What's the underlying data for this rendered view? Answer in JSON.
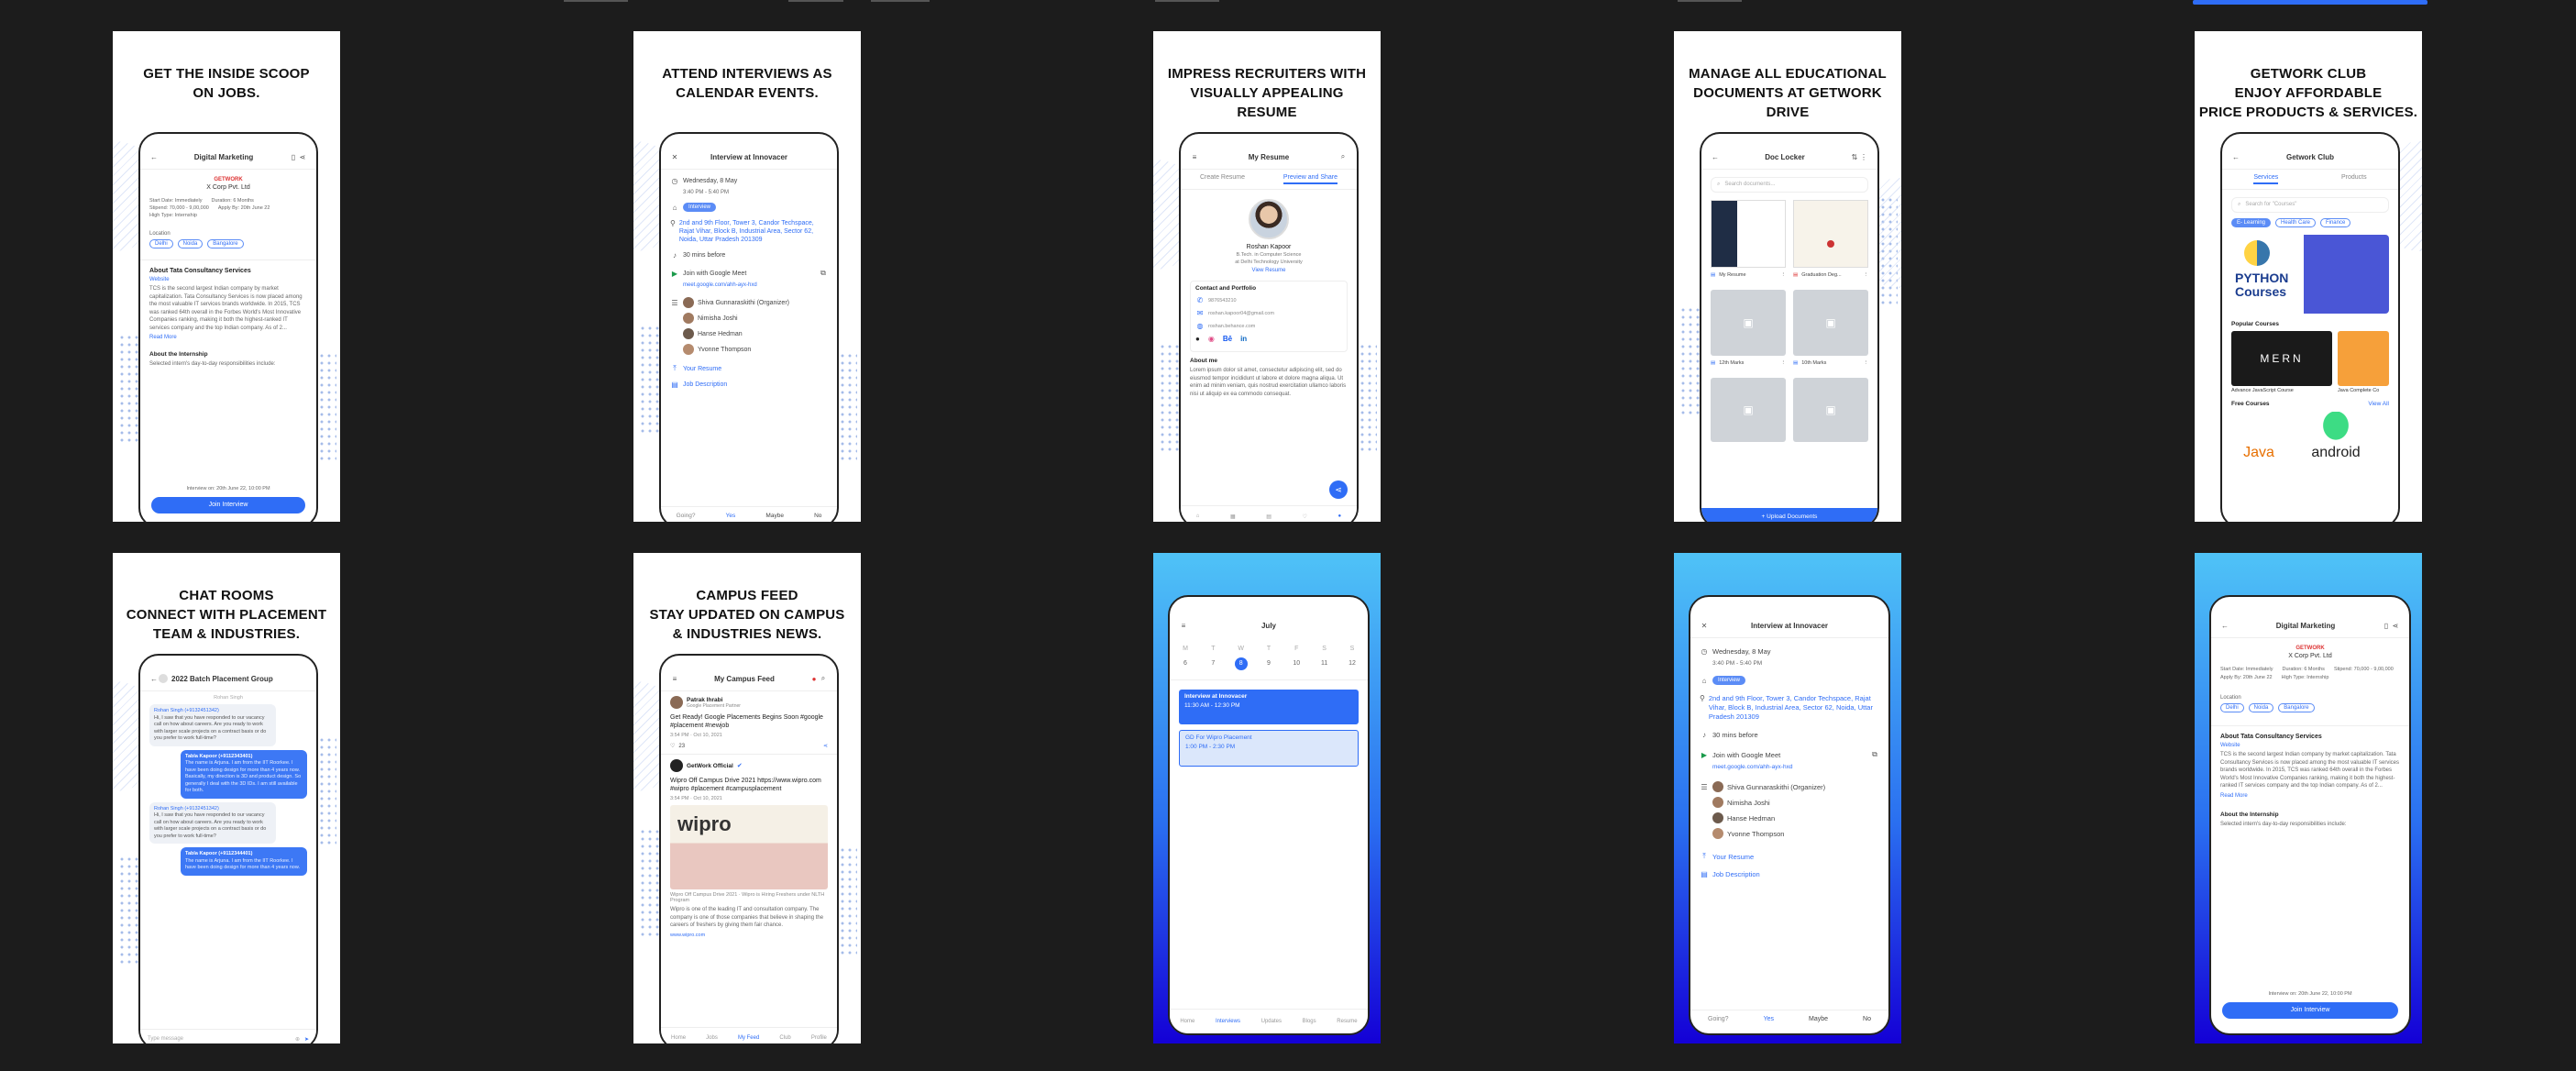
{
  "cards": {
    "c1": {
      "title": "GET THE INSIDE SCOOP\nON JOBS.",
      "header": "Digital Marketing",
      "company_logo": "GETWORK",
      "company": "X Corp Pvt. Ltd",
      "start_date_label": "Start Date: Immediately",
      "duration_label": "Duration: 6 Months",
      "stipend_label": "Stipend: 70,000 - 9,00,000",
      "apply_by_label": "Apply By: 20th June 22",
      "type_label": "High Type: Internship",
      "location_label": "Location",
      "locations": [
        "Delhi",
        "Noida",
        "Bangalore"
      ],
      "about_company": "About Tata Consultancy Services",
      "website": "Website",
      "about_text": "TCS is the second largest Indian company by market capitalization. Tata Consultancy Services is now placed among the most valuable IT services brands worldwide. In 2015, TCS was ranked 64th overall in the Forbes World's Most Innovative Companies ranking, making it both the highest-ranked IT services company and the top Indian company. As of 2...",
      "read_more": "Read More",
      "about_internship": "About the Internship",
      "internship_text": "Selected intern's day-to-day responsibilities include:",
      "interview_note": "Interview on: 20th June 22, 10:00 PM",
      "join_button": "Join Interview"
    },
    "c2": {
      "title": "ATTEND INTERVIEWS AS\nCALENDAR EVENTS.",
      "header": "Interview at Innovacer",
      "date": "Wednesday, 8 May",
      "time": "3:40 PM - 5:40 PM",
      "tag": "Interview",
      "address": "2nd and 9th Floor, Tower 3, Candor Techspace, Rajat Vihar, Block B, Industrial Area, Sector 62, Noida, Uttar Pradesh 201309",
      "reminder": "30 mins before",
      "meet_label": "Join with Google Meet",
      "meet_link": "meet.google.com/ahh-ayx-hxd",
      "guests": [
        "Shiva Gunnaraskithi (Organizer)",
        "Nimisha Joshi",
        "Hanse Hedman",
        "Yvonne Thompson"
      ],
      "your_resume": "Your Resume",
      "job_description": "Job Description",
      "going": "Going?",
      "yes": "Yes",
      "maybe": "Maybe",
      "no": "No"
    },
    "c3": {
      "title": "IMPRESS RECRUITERS WITH\nVISUALLY APPEALING\nRESUME",
      "header": "My Resume",
      "tab_create": "Create Resume",
      "tab_preview": "Preview and Share",
      "name": "Roshan Kapoor",
      "degree": "B.Tech. in Computer Science",
      "university": "at Delhi Technology University",
      "view_resume": "View Resume",
      "contact_heading": "Contact and Portfolio",
      "phone": "9876543210",
      "email": "roshan.kapoor04@gmail.com",
      "site": "roshan.behance.com",
      "about_heading": "About me",
      "about_text": "Lorem ipsum dolor sit amet, consectetur adipiscing elit, sed do eiusmod tempor incididunt ut labore et dolore magna aliqua. Ut enim ad minim veniam, quis nostrud exercitation ullamco laboris nisi ut aliquip ex ea commodo consequat."
    },
    "c4": {
      "title": "MANAGE ALL EDUCATIONAL\nDOCUMENTS AT GETWORK\nDRIVE",
      "header": "Doc Locker",
      "search_placeholder": "Search documents...",
      "docs": [
        "My Resume",
        "Graduation Deg...",
        "12th Marks",
        "10th Marks",
        "",
        ""
      ],
      "upload_button": "+ Upload Documents"
    },
    "c5": {
      "title": "GETWORK CLUB\nENJOY AFFORDABLE\nPRICE PRODUCTS & SERVICES.",
      "header": "Getwork Club",
      "tab_services": "Services",
      "tab_products": "Products",
      "search_placeholder": "Search for \"Courses\"",
      "chips": [
        "E- Learning",
        "Health Care",
        "Finance"
      ],
      "banner_text": "PYTHON Courses",
      "popular_heading": "Popular Courses",
      "popular": [
        "Advance JavaScript Course",
        "Java Complete Co"
      ],
      "mern": "MERN",
      "free_heading": "Free Courses",
      "view_all": "View All",
      "free": [
        "Java",
        "android"
      ]
    },
    "c6": {
      "title": "CHAT ROOMS\nCONNECT WITH PLACEMENT\nTEAM & INDUSTRIES.",
      "header": "2022 Batch Placement Group",
      "sub": "Rohan Singh",
      "messages": [
        {
          "side": "l",
          "name": "Rohan Singh (+9132451342)",
          "text": "Hi, I saw that you have responded to our vacancy call on how about careers. Are you ready to work with larger scale projects on a contract basis or do you prefer to work full-time?"
        },
        {
          "side": "r",
          "name": "Tabla Kapoor (+9112343401)",
          "text": "The name is Arjuna. I am from the IIT Roorkee. I have been doing design for more than 4 years now. Basically, my direction is 3D and product design. So generally I deal with the 3D IDs. I am still available for both."
        },
        {
          "side": "l",
          "name": "Rohan Singh (+9132451342)",
          "text": "Hi, I saw that you have responded to our vacancy call on how about careers. Are you ready to work with larger scale projects on a contract basis or do you prefer to work full-time?"
        },
        {
          "side": "r",
          "name": "Tabla Kapoor (+9112344401)",
          "text": "The name is Arjuna. I am from the IIT Roorkee. I have been doing design for more than 4 years now."
        }
      ],
      "input_placeholder": "Type message"
    },
    "c7": {
      "title": "CAMPUS FEED\nSTAY UPDATED ON CAMPUS\n& INDUSTRIES NEWS.",
      "header": "My Campus Feed",
      "post1_author": "Patrak Ihrabi",
      "post1_role": "Google Placement Partner",
      "post1_text": "Get Ready! Google Placements Begins Soon #google #placement #newjob",
      "post1_time": "3:54 PM · Oct 10, 2021",
      "likes": "23",
      "post2_author": "GetWork Official",
      "post2_text": "Wipro Off Campus Drive 2021 https://www.wipro.com #wipro #placement #campusplacement",
      "post2_time": "3:54 PM · Oct 10, 2021",
      "image_text": "wipro",
      "post2_caption": "Wipro Off Campus Drive 2021 · Wipro is Hiring Freshers under NLTH Program",
      "post2_body": "Wipro is one of the leading IT and consultation company. The company is one of those companies that believe in shaping the careers of freshers by giving them fair chance.",
      "post2_link": "www.wipro.com",
      "nav": [
        "Home",
        "Jobs",
        "My Feed",
        "Club",
        "Profile"
      ]
    },
    "c8": {
      "month": "July",
      "weekdays": [
        "M",
        "T",
        "W",
        "T",
        "F",
        "S",
        "S"
      ],
      "days": [
        "6",
        "7",
        "8",
        "9",
        "10",
        "11",
        "12"
      ],
      "event1_title": "Interview at Innovacer",
      "event1_time": "11:30 AM - 12:30 PM",
      "event2_title": "GD For Wipro Placement",
      "event2_time": "1:00 PM - 2:30 PM",
      "nav": [
        "Home",
        "Interviews",
        "Updates",
        "Blogs",
        "Resume"
      ]
    },
    "c9": {
      "header": "Interview at Innovacer",
      "date": "Wednesday, 8 May",
      "time": "3:40 PM - 5:40 PM",
      "tag": "Interview",
      "address": "2nd and 9th Floor, Tower 3, Candor Techspace, Rajat Vihar, Block B, Industrial Area, Sector 62, Noida, Uttar Pradesh 201309",
      "reminder": "30 mins before",
      "meet_label": "Join with Google Meet",
      "meet_link": "meet.google.com/ahh-ayx-hxd",
      "guests": [
        "Shiva Gunnaraskithi (Organizer)",
        "Nimisha Joshi",
        "Hanse Hedman",
        "Yvonne Thompson"
      ],
      "your_resume": "Your Resume",
      "job_description": "Job Description",
      "going": "Going?",
      "yes": "Yes",
      "maybe": "Maybe",
      "no": "No"
    },
    "c10": {
      "header": "Digital Marketing",
      "company_logo": "GETWORK",
      "company": "X Corp Pvt. Ltd",
      "start_date_label": "Start Date: Immediately",
      "duration_label": "Duration: 6 Months",
      "stipend_label": "Stipend: 70,000 - 9,00,000",
      "apply_by_label": "Apply By: 20th June 22",
      "type_label": "High Type: Internship",
      "location_label": "Location",
      "locations": [
        "Delhi",
        "Noida",
        "Bangalore"
      ],
      "about_company": "About Tata Consultancy Services",
      "website": "Website",
      "about_text": "TCS is the second largest Indian company by market capitalization. Tata Consultancy Services is now placed among the most valuable IT services brands worldwide. In 2015, TCS was ranked 64th overall in the Forbes World's Most Innovative Companies ranking, making it both the highest-ranked IT services company and the top Indian company. As of 2...",
      "read_more": "Read More",
      "about_internship": "About the Internship",
      "internship_text": "Selected intern's day-to-day responsibilities include:",
      "interview_note": "Interview on: 20th June 22, 10:00 PM",
      "join_button": "Join Interview"
    }
  },
  "colors": {
    "accent": "#2f6df6",
    "background": "#1c1c1c",
    "gradient_top": "#4fc3f7",
    "gradient_bottom": "#1400d6"
  }
}
